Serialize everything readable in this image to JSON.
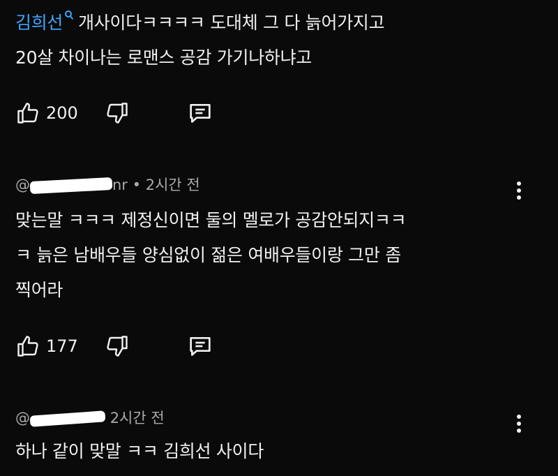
{
  "comments": [
    {
      "mention": "김희선",
      "text_line1": "개사이다ㅋㅋㅋㅋ 도대체 그 다 늙어가지고",
      "text_line2": "20살 차이나는 로맨스 공감 가기나하냐고",
      "likes": "200"
    },
    {
      "author_suffix": "nr",
      "time": "• 2시간 전",
      "text_line1": "맞는말 ㅋㅋㅋ 제정신이면 둘의 멜로가 공감안되지ㅋㅋ",
      "text_line2": "ㅋ 늙은 남배우들 양심없이 젊은 여배우들이랑 그만 좀",
      "text_line3": "찍어라",
      "likes": "177"
    },
    {
      "author_prefix": "@",
      "time": "2시간 전",
      "text_line1": "하나 같이 맞말 ㅋㅋ 김희선 사이다"
    }
  ],
  "icons": {
    "like": "thumbs-up-icon",
    "dislike": "thumbs-down-icon",
    "reply": "reply-comment-icon",
    "more": "more-vertical-icon",
    "mention": "search-mention-icon"
  },
  "colors": {
    "background": "#0a0a0a",
    "mention": "#3ea6ff",
    "text": "#f1f1f1",
    "meta": "#aaaaaa"
  }
}
